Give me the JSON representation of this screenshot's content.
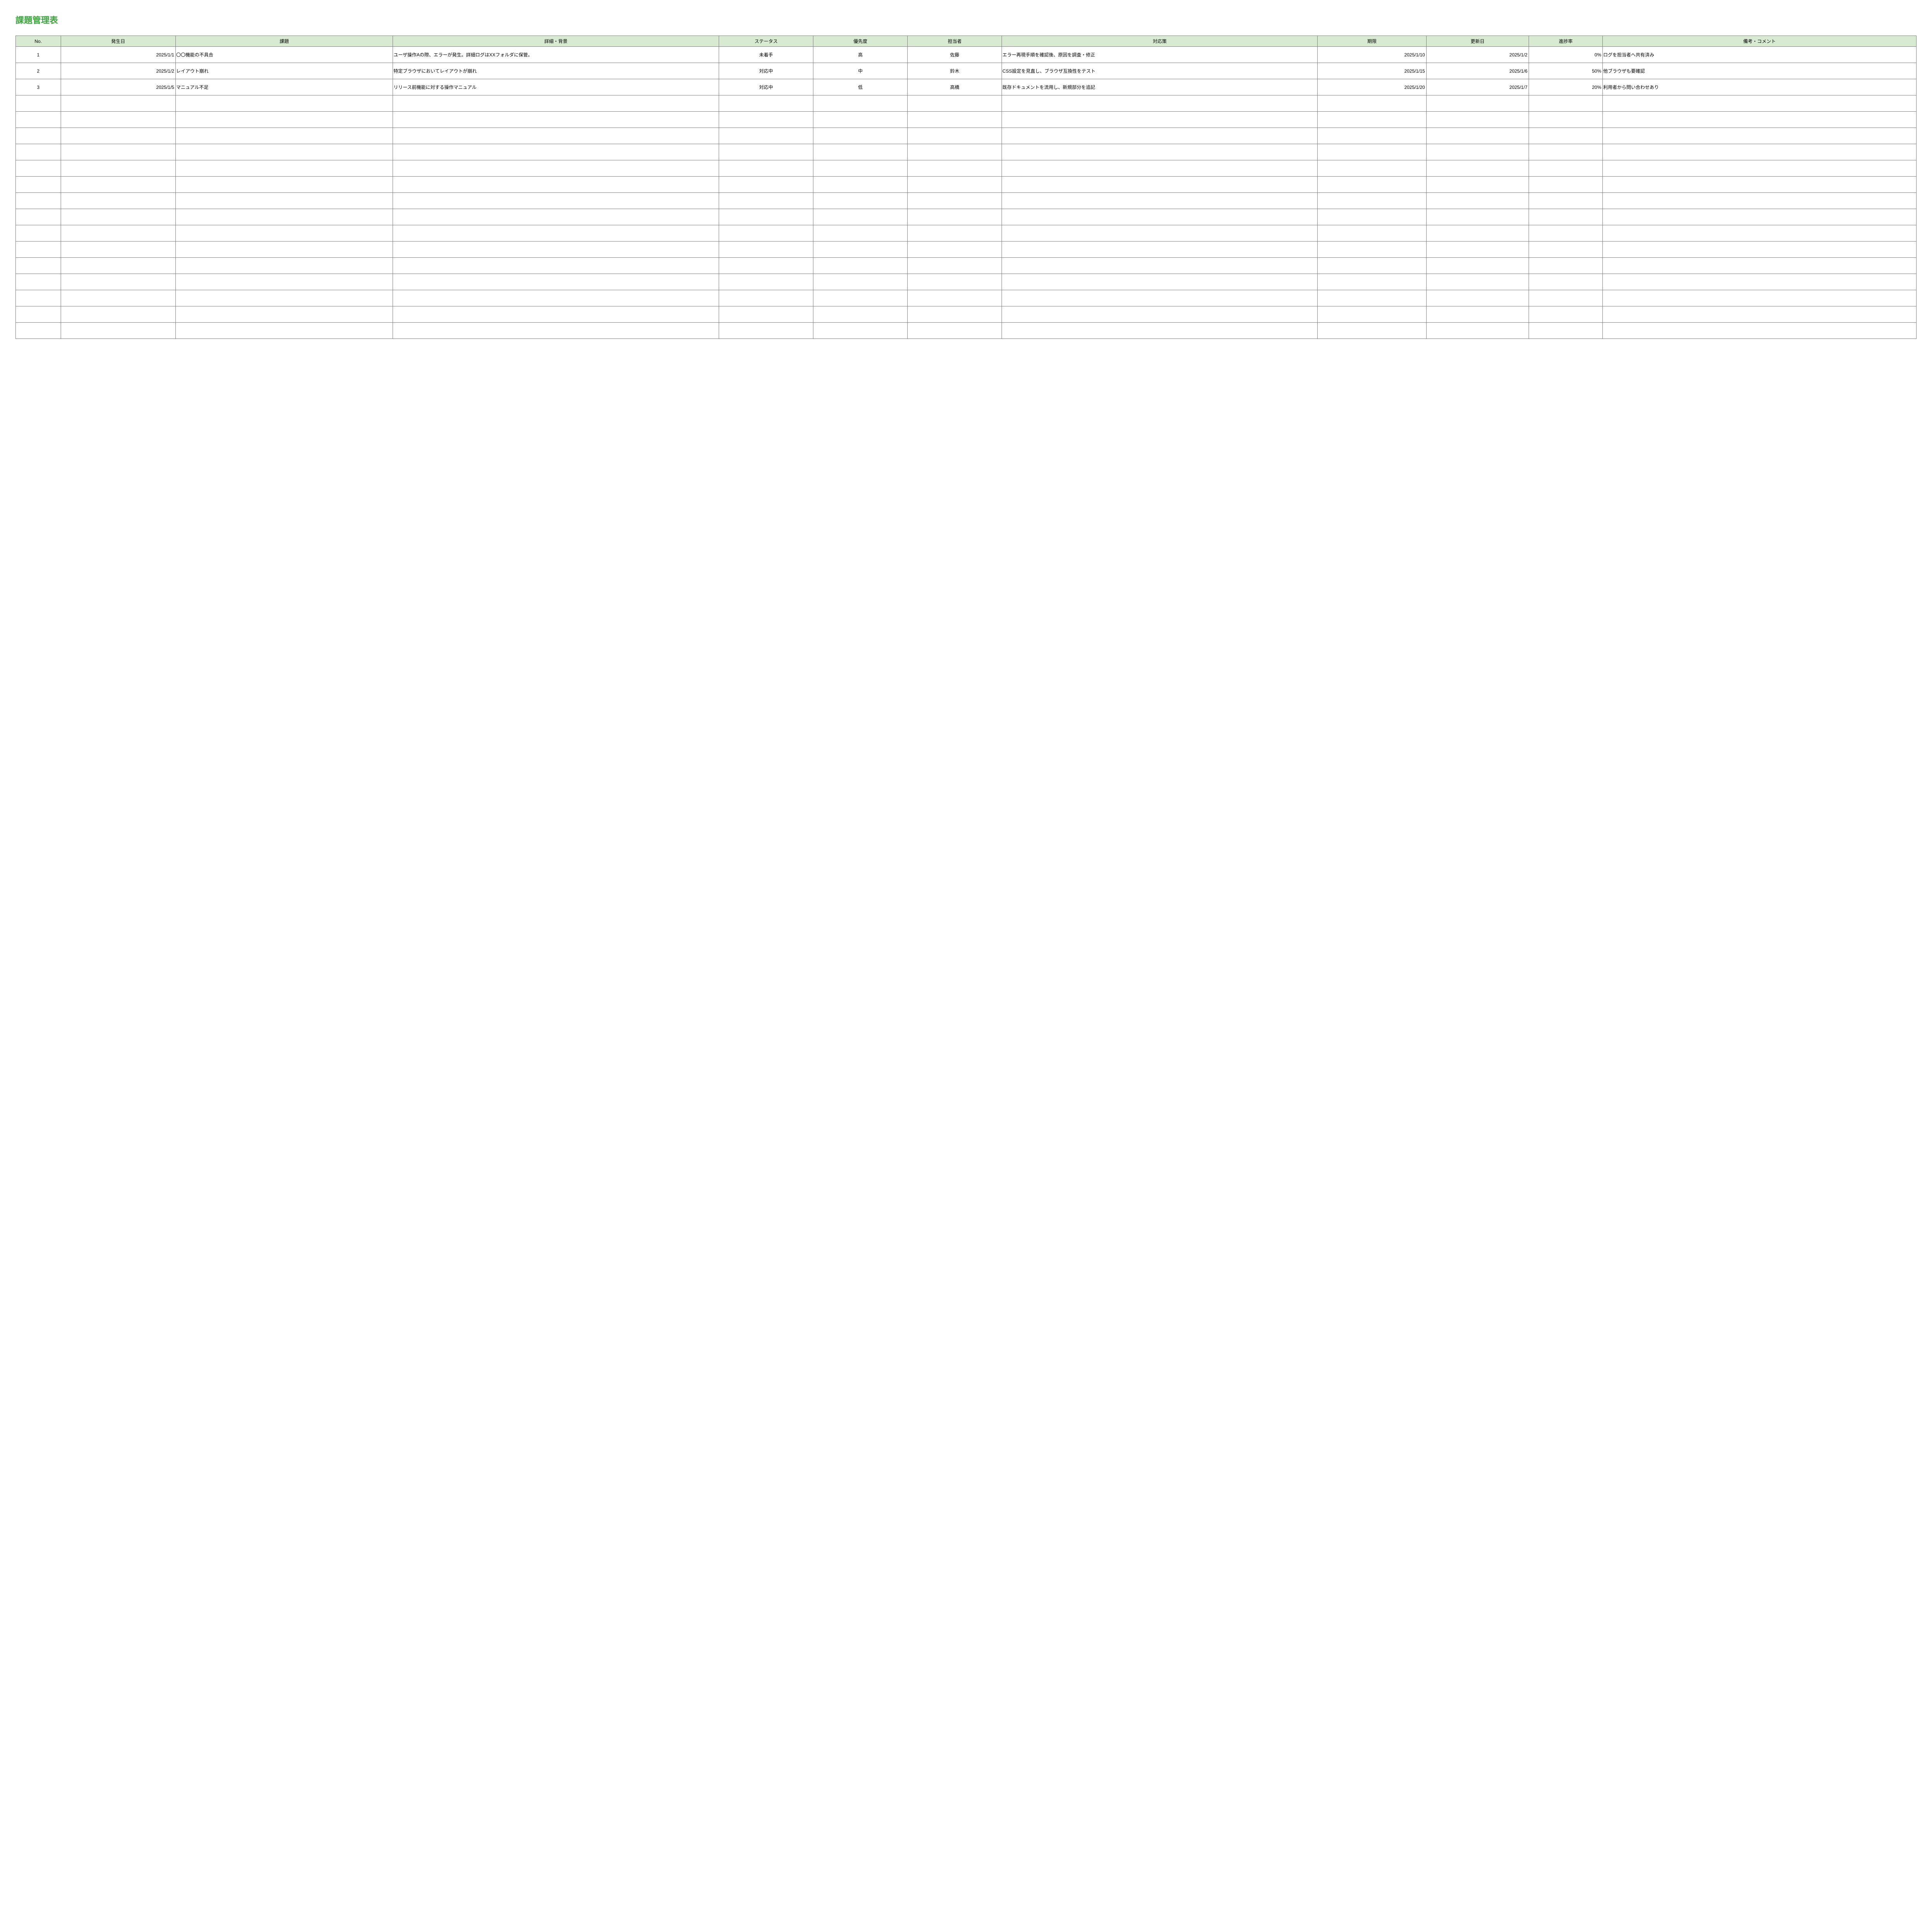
{
  "title": "課題管理表",
  "headers": {
    "no": "No.",
    "date": "発生日",
    "issue": "課題",
    "detail": "詳細・背景",
    "status": "ステータス",
    "priority": "優先度",
    "owner": "担当者",
    "action": "対応策",
    "due": "期限",
    "updated": "更新日",
    "progress": "進捗率",
    "note": "備考・コメント"
  },
  "rows": [
    {
      "no": "1",
      "date": "2025/1/1",
      "issue": "〇〇機能の不具合",
      "detail": "ユーザ操作Aの際、エラーが発生。詳細ログはXXフォルダに保管。",
      "status": "未着手",
      "priority": "高",
      "owner": "佐藤",
      "action": "エラー再現手順を確認後、原因を調査・修正",
      "due": "2025/1/10",
      "updated": "2025/1/2",
      "progress": "0%",
      "note": "ログを担当者へ共有済み"
    },
    {
      "no": "2",
      "date": "2025/1/2",
      "issue": "レイアウト崩れ",
      "detail": "特定ブラウザにおいてレイアウトが崩れ",
      "status": "対応中",
      "priority": "中",
      "owner": "鈴木",
      "action": "CSS設定を見直し、ブラウザ互換性をテスト",
      "due": "2025/1/15",
      "updated": "2025/1/6",
      "progress": "50%",
      "note": "他ブラウザも要確認"
    },
    {
      "no": "3",
      "date": "2025/1/5",
      "issue": "マニュアル不足",
      "detail": "リリース前機能に対する操作マニュアル",
      "status": "対応中",
      "priority": "低",
      "owner": "高橋",
      "action": "既存ドキュメントを流用し、新規部分を追記",
      "due": "2025/1/20",
      "updated": "2025/1/7",
      "progress": "20%",
      "note": "利用者から問い合わせあり"
    }
  ],
  "emptyRowCount": 15
}
